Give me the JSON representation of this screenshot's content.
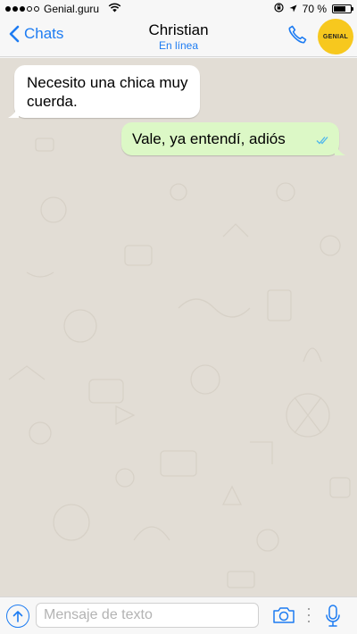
{
  "status_bar": {
    "signal_dots_filled": 3,
    "signal_dots_total": 5,
    "carrier": "Genial.guru",
    "battery_label": "70 %",
    "battery_level": 0.7
  },
  "nav": {
    "back_label": "Chats",
    "contact_name": "Christian",
    "contact_status": "En línea",
    "avatar_label": "GENIAL",
    "accent_color": "#1d7cf2",
    "avatar_color": "#f7c81e"
  },
  "messages": [
    {
      "direction": "incoming",
      "text": "Necesito una chica muy cuerda."
    },
    {
      "direction": "outgoing",
      "text": "Vale, ya entendí, adiós",
      "read": true
    }
  ],
  "input_bar": {
    "placeholder": "Mensaje de texto"
  },
  "icons": {
    "back": "chevron-left-icon",
    "call": "phone-icon",
    "share": "arrow-up-icon",
    "camera": "camera-icon",
    "mic": "microphone-icon",
    "wifi": "wifi-icon",
    "location": "location-arrow-icon",
    "lock": "rotation-lock-icon"
  },
  "colors": {
    "chat_background": "#e2ddd5",
    "incoming_bubble": "#ffffff",
    "outgoing_bubble": "#dcf8c6",
    "read_ticks": "#4fb6ec"
  }
}
